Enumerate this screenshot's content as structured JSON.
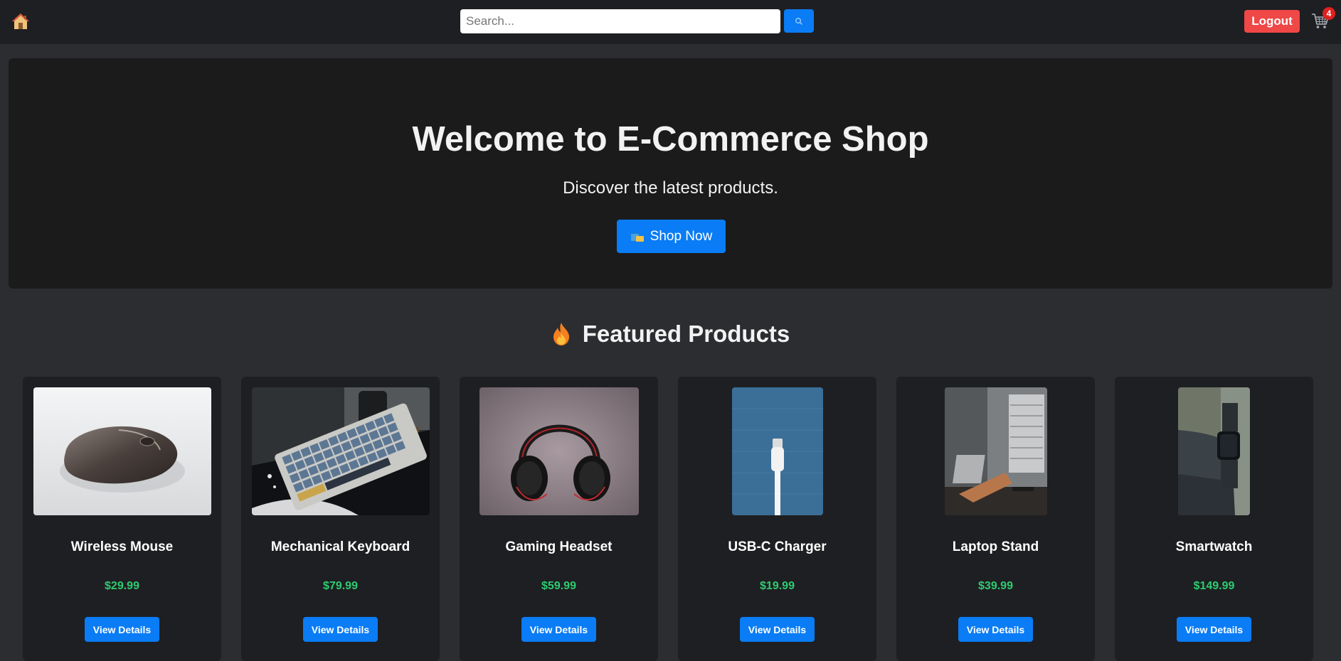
{
  "navbar": {
    "home_icon": "house-icon",
    "search": {
      "placeholder": "Search...",
      "value": "",
      "button_icon": "search-icon"
    },
    "logout_label": "Logout",
    "cart": {
      "icon": "cart-icon",
      "count": "4"
    }
  },
  "hero": {
    "title": "Welcome to E-Commerce Shop",
    "subtitle": "Discover the latest products.",
    "cta_label": "Shop Now",
    "cta_icon": "shopping-bags-icon"
  },
  "featured": {
    "icon": "fire-icon",
    "title": "Featured Products",
    "products": [
      {
        "name": "Wireless Mouse",
        "price": "$29.99",
        "button_label": "View Details",
        "image": "wireless-mouse-photo"
      },
      {
        "name": "Mechanical Keyboard",
        "price": "$79.99",
        "button_label": "View Details",
        "image": "mechanical-keyboard-photo"
      },
      {
        "name": "Gaming Headset",
        "price": "$59.99",
        "button_label": "View Details",
        "image": "gaming-headset-photo"
      },
      {
        "name": "USB-C Charger",
        "price": "$19.99",
        "button_label": "View Details",
        "image": "usb-c-cable-photo"
      },
      {
        "name": "Laptop Stand",
        "price": "$39.99",
        "button_label": "View Details",
        "image": "laptop-stand-photo"
      },
      {
        "name": "Smartwatch",
        "price": "$149.99",
        "button_label": "View Details",
        "image": "smartwatch-photo"
      }
    ]
  },
  "colors": {
    "page_bg": "#2b2d31",
    "navbar_bg": "#1e1f22",
    "hero_bg": "#1b1b1c",
    "card_bg": "#1e1f22",
    "primary": "#0a7cf5",
    "danger": "#f04747",
    "price": "#2ecc71"
  }
}
